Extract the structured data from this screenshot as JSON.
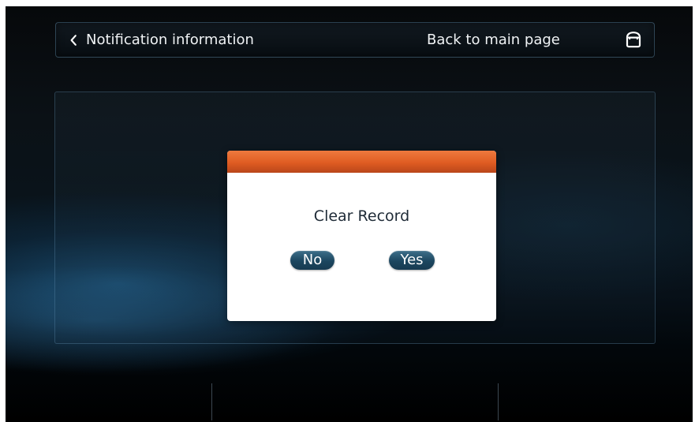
{
  "header": {
    "back_icon": "chevron-left-icon",
    "title": "Notification information",
    "main_page_link": "Back to main page",
    "home_icon": "home-icon"
  },
  "dialog": {
    "title": "Clear Record",
    "buttons": {
      "no": "No",
      "yes": "Yes"
    }
  },
  "colors": {
    "dialog_header_accent": "#df5c22",
    "button_fill": "#1c465f",
    "dialog_body": "#ffffff",
    "panel_border": "#6e9fc2"
  }
}
